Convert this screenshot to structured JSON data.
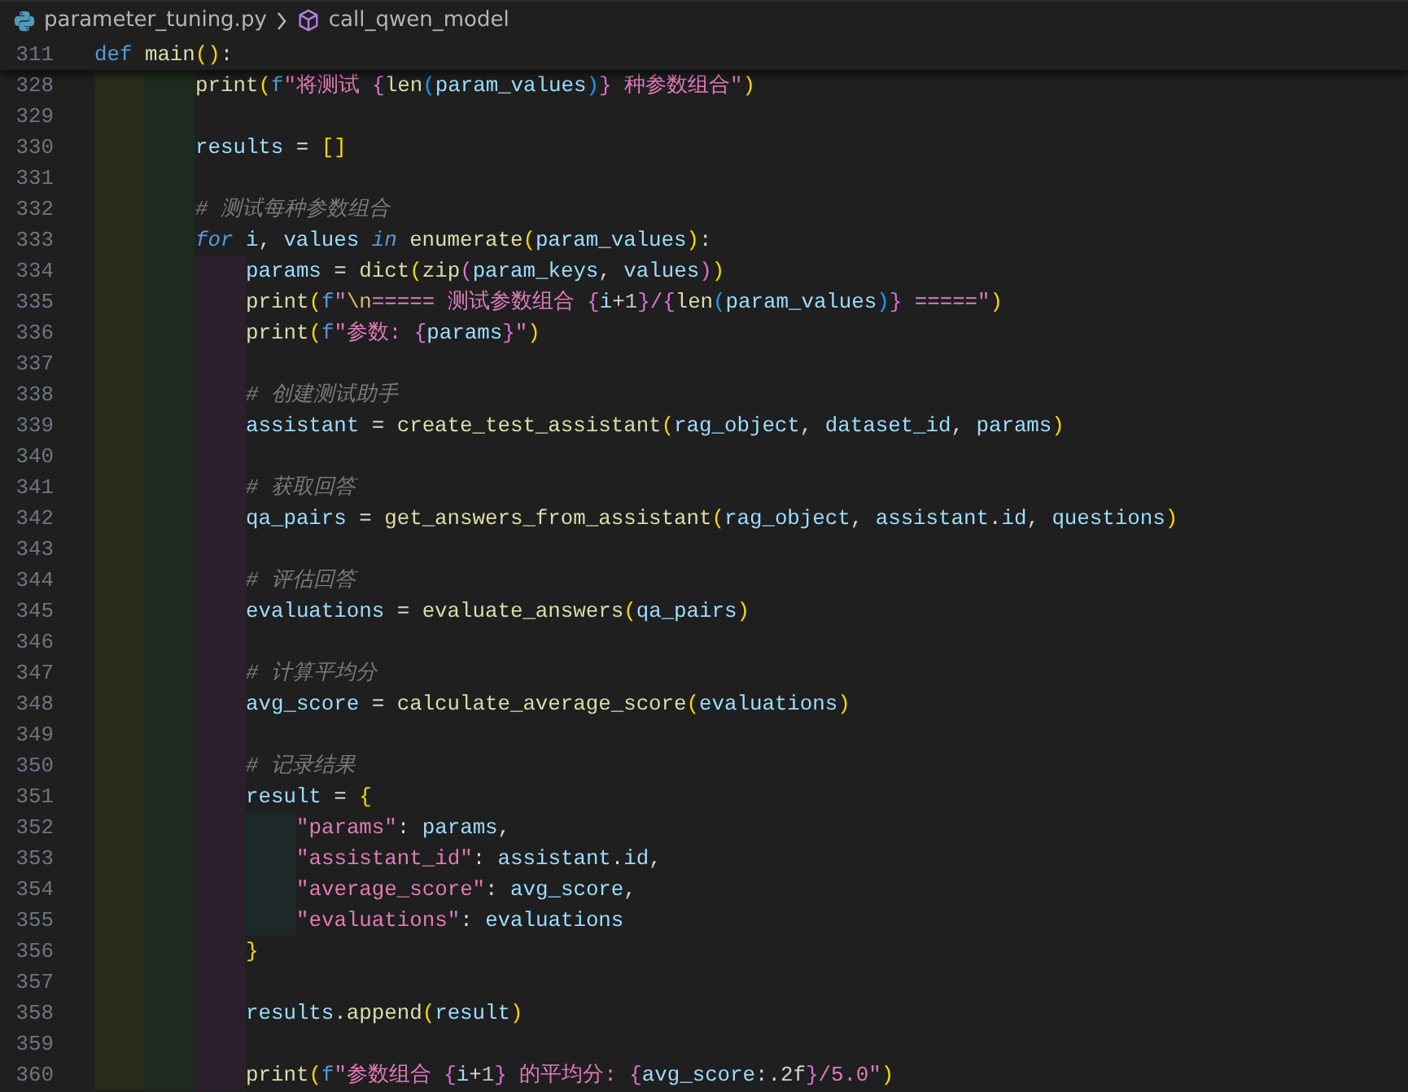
{
  "breadcrumb": {
    "file": "parameter_tuning.py",
    "symbol": "call_qwen_model"
  },
  "sticky_line": {
    "number": "311",
    "tokens": [
      {
        "kind": "keyword",
        "text": "def "
      },
      {
        "kind": "function",
        "text": "main"
      },
      {
        "kind": "bracket1",
        "text": "()"
      },
      {
        "kind": "plain",
        "text": ":"
      }
    ]
  },
  "lines": [
    {
      "children": [
        {
          "children": [
            {
              "number": "328",
              "tokens": [
                {
                  "kind": "function",
                  "text": "print"
                },
                {
                  "kind": "bracket1",
                  "text": "("
                },
                {
                  "kind": "keyword",
                  "text": "f"
                },
                {
                  "kind": "string",
                  "text": "\"将测试 "
                },
                {
                  "kind": "bracket2",
                  "text": "{"
                },
                {
                  "kind": "function",
                  "text": "len"
                },
                {
                  "kind": "bracket3",
                  "text": "("
                },
                {
                  "kind": "variable",
                  "text": "param_values"
                },
                {
                  "kind": "bracket3",
                  "text": ")"
                },
                {
                  "kind": "bracket2",
                  "text": "}"
                },
                {
                  "kind": "string",
                  "text": " 种参数组合\""
                },
                {
                  "kind": "bracket1",
                  "text": ")"
                }
              ]
            },
            {
              "number": "329"
            },
            {
              "number": "330",
              "tokens": [
                {
                  "kind": "variable",
                  "text": "results"
                },
                {
                  "kind": "plain",
                  "text": " = "
                },
                {
                  "kind": "bracket1",
                  "text": "[]"
                }
              ]
            },
            {
              "number": "331"
            },
            {
              "number": "332",
              "tokens": [
                {
                  "kind": "comment",
                  "text": "# 测试每种参数组合"
                }
              ]
            },
            {
              "number": "333",
              "tokens": [
                {
                  "kind": "control",
                  "text": "for "
                },
                {
                  "kind": "variable",
                  "text": "i"
                },
                {
                  "kind": "plain",
                  "text": ", "
                },
                {
                  "kind": "variable",
                  "text": "values "
                },
                {
                  "kind": "control",
                  "text": "in "
                },
                {
                  "kind": "function",
                  "text": "enumerate"
                },
                {
                  "kind": "bracket1",
                  "text": "("
                },
                {
                  "kind": "variable",
                  "text": "param_values"
                },
                {
                  "kind": "bracket1",
                  "text": ")"
                },
                {
                  "kind": "plain",
                  "text": ":"
                }
              ],
              "children": [
                {
                  "number": "334",
                  "tokens": [
                    {
                      "kind": "variable",
                      "text": "params"
                    },
                    {
                      "kind": "plain",
                      "text": " = "
                    },
                    {
                      "kind": "function",
                      "text": "dict"
                    },
                    {
                      "kind": "bracket1",
                      "text": "("
                    },
                    {
                      "kind": "function",
                      "text": "zip"
                    },
                    {
                      "kind": "bracket2",
                      "text": "("
                    },
                    {
                      "kind": "variable",
                      "text": "param_keys"
                    },
                    {
                      "kind": "plain",
                      "text": ", "
                    },
                    {
                      "kind": "variable",
                      "text": "values"
                    },
                    {
                      "kind": "bracket2",
                      "text": ")"
                    },
                    {
                      "kind": "bracket1",
                      "text": ")"
                    }
                  ]
                },
                {
                  "number": "335",
                  "tokens": [
                    {
                      "kind": "function",
                      "text": "print"
                    },
                    {
                      "kind": "bracket1",
                      "text": "("
                    },
                    {
                      "kind": "keyword",
                      "text": "f"
                    },
                    {
                      "kind": "string",
                      "text": "\""
                    },
                    {
                      "kind": "escape",
                      "text": "\\n"
                    },
                    {
                      "kind": "string",
                      "text": "===== 测试参数组合 "
                    },
                    {
                      "kind": "bracket2",
                      "text": "{"
                    },
                    {
                      "kind": "variable",
                      "text": "i"
                    },
                    {
                      "kind": "plain",
                      "text": "+"
                    },
                    {
                      "kind": "number",
                      "text": "1"
                    },
                    {
                      "kind": "bracket2",
                      "text": "}"
                    },
                    {
                      "kind": "string",
                      "text": "/"
                    },
                    {
                      "kind": "bracket2",
                      "text": "{"
                    },
                    {
                      "kind": "function",
                      "text": "len"
                    },
                    {
                      "kind": "bracket3",
                      "text": "("
                    },
                    {
                      "kind": "variable",
                      "text": "param_values"
                    },
                    {
                      "kind": "bracket3",
                      "text": ")"
                    },
                    {
                      "kind": "bracket2",
                      "text": "}"
                    },
                    {
                      "kind": "string",
                      "text": " =====\""
                    },
                    {
                      "kind": "bracket1",
                      "text": ")"
                    }
                  ]
                },
                {
                  "number": "336",
                  "tokens": [
                    {
                      "kind": "function",
                      "text": "print"
                    },
                    {
                      "kind": "bracket1",
                      "text": "("
                    },
                    {
                      "kind": "keyword",
                      "text": "f"
                    },
                    {
                      "kind": "string",
                      "text": "\"参数: "
                    },
                    {
                      "kind": "bracket2",
                      "text": "{"
                    },
                    {
                      "kind": "variable",
                      "text": "params"
                    },
                    {
                      "kind": "bracket2",
                      "text": "}"
                    },
                    {
                      "kind": "string",
                      "text": "\""
                    },
                    {
                      "kind": "bracket1",
                      "text": ")"
                    }
                  ]
                },
                {
                  "number": "337"
                },
                {
                  "number": "338",
                  "tokens": [
                    {
                      "kind": "comment",
                      "text": "# 创建测试助手"
                    }
                  ]
                },
                {
                  "number": "339",
                  "tokens": [
                    {
                      "kind": "variable",
                      "text": "assistant"
                    },
                    {
                      "kind": "plain",
                      "text": " = "
                    },
                    {
                      "kind": "function",
                      "text": "create_test_assistant"
                    },
                    {
                      "kind": "bracket1",
                      "text": "("
                    },
                    {
                      "kind": "variable",
                      "text": "rag_object"
                    },
                    {
                      "kind": "plain",
                      "text": ", "
                    },
                    {
                      "kind": "variable",
                      "text": "dataset_id"
                    },
                    {
                      "kind": "plain",
                      "text": ", "
                    },
                    {
                      "kind": "variable",
                      "text": "params"
                    },
                    {
                      "kind": "bracket1",
                      "text": ")"
                    }
                  ]
                },
                {
                  "number": "340"
                },
                {
                  "number": "341",
                  "tokens": [
                    {
                      "kind": "comment",
                      "text": "# 获取回答"
                    }
                  ]
                },
                {
                  "number": "342",
                  "tokens": [
                    {
                      "kind": "variable",
                      "text": "qa_pairs"
                    },
                    {
                      "kind": "plain",
                      "text": " = "
                    },
                    {
                      "kind": "function",
                      "text": "get_answers_from_assistant"
                    },
                    {
                      "kind": "bracket1",
                      "text": "("
                    },
                    {
                      "kind": "variable",
                      "text": "rag_object"
                    },
                    {
                      "kind": "plain",
                      "text": ", "
                    },
                    {
                      "kind": "variable",
                      "text": "assistant"
                    },
                    {
                      "kind": "plain",
                      "text": "."
                    },
                    {
                      "kind": "variable",
                      "text": "id"
                    },
                    {
                      "kind": "plain",
                      "text": ", "
                    },
                    {
                      "kind": "variable",
                      "text": "questions"
                    },
                    {
                      "kind": "bracket1",
                      "text": ")"
                    }
                  ]
                },
                {
                  "number": "343"
                },
                {
                  "number": "344",
                  "tokens": [
                    {
                      "kind": "comment",
                      "text": "# 评估回答"
                    }
                  ]
                },
                {
                  "number": "345",
                  "tokens": [
                    {
                      "kind": "variable",
                      "text": "evaluations"
                    },
                    {
                      "kind": "plain",
                      "text": " = "
                    },
                    {
                      "kind": "function",
                      "text": "evaluate_answers"
                    },
                    {
                      "kind": "bracket1",
                      "text": "("
                    },
                    {
                      "kind": "variable",
                      "text": "qa_pairs"
                    },
                    {
                      "kind": "bracket1",
                      "text": ")"
                    }
                  ]
                },
                {
                  "number": "346"
                },
                {
                  "number": "347",
                  "tokens": [
                    {
                      "kind": "comment",
                      "text": "# 计算平均分"
                    }
                  ]
                },
                {
                  "number": "348",
                  "tokens": [
                    {
                      "kind": "variable",
                      "text": "avg_score"
                    },
                    {
                      "kind": "plain",
                      "text": " = "
                    },
                    {
                      "kind": "function",
                      "text": "calculate_average_score"
                    },
                    {
                      "kind": "bracket1",
                      "text": "("
                    },
                    {
                      "kind": "variable",
                      "text": "evaluations"
                    },
                    {
                      "kind": "bracket1",
                      "text": ")"
                    }
                  ]
                },
                {
                  "number": "349"
                },
                {
                  "number": "350",
                  "tokens": [
                    {
                      "kind": "comment",
                      "text": "# 记录结果"
                    }
                  ]
                },
                {
                  "number": "351",
                  "tokens": [
                    {
                      "kind": "variable",
                      "text": "result"
                    },
                    {
                      "kind": "plain",
                      "text": " = "
                    },
                    {
                      "kind": "bracket1",
                      "text": "{"
                    }
                  ],
                  "children": [
                    {
                      "number": "352",
                      "tokens": [
                        {
                          "kind": "string",
                          "text": "\"params\""
                        },
                        {
                          "kind": "plain",
                          "text": ": "
                        },
                        {
                          "kind": "variable",
                          "text": "params"
                        },
                        {
                          "kind": "plain",
                          "text": ","
                        }
                      ]
                    },
                    {
                      "number": "353",
                      "tokens": [
                        {
                          "kind": "string",
                          "text": "\"assistant_id\""
                        },
                        {
                          "kind": "plain",
                          "text": ": "
                        },
                        {
                          "kind": "variable",
                          "text": "assistant"
                        },
                        {
                          "kind": "plain",
                          "text": "."
                        },
                        {
                          "kind": "variable",
                          "text": "id"
                        },
                        {
                          "kind": "plain",
                          "text": ","
                        }
                      ]
                    },
                    {
                      "number": "354",
                      "tokens": [
                        {
                          "kind": "string",
                          "text": "\"average_score\""
                        },
                        {
                          "kind": "plain",
                          "text": ": "
                        },
                        {
                          "kind": "variable",
                          "text": "avg_score"
                        },
                        {
                          "kind": "plain",
                          "text": ","
                        }
                      ]
                    },
                    {
                      "number": "355",
                      "tokens": [
                        {
                          "kind": "string",
                          "text": "\"evaluations\""
                        },
                        {
                          "kind": "plain",
                          "text": ": "
                        },
                        {
                          "kind": "variable",
                          "text": "evaluations"
                        }
                      ]
                    }
                  ]
                },
                {
                  "number": "356",
                  "tokens": [
                    {
                      "kind": "bracket1",
                      "text": "}"
                    }
                  ]
                },
                {
                  "number": "357"
                },
                {
                  "number": "358",
                  "tokens": [
                    {
                      "kind": "variable",
                      "text": "results"
                    },
                    {
                      "kind": "plain",
                      "text": "."
                    },
                    {
                      "kind": "function",
                      "text": "append"
                    },
                    {
                      "kind": "bracket1",
                      "text": "("
                    },
                    {
                      "kind": "variable",
                      "text": "result"
                    },
                    {
                      "kind": "bracket1",
                      "text": ")"
                    }
                  ]
                },
                {
                  "number": "359"
                },
                {
                  "number": "360",
                  "tokens": [
                    {
                      "kind": "function",
                      "text": "print"
                    },
                    {
                      "kind": "bracket1",
                      "text": "("
                    },
                    {
                      "kind": "keyword",
                      "text": "f"
                    },
                    {
                      "kind": "string",
                      "text": "\"参数组合 "
                    },
                    {
                      "kind": "bracket2",
                      "text": "{"
                    },
                    {
                      "kind": "variable",
                      "text": "i"
                    },
                    {
                      "kind": "plain",
                      "text": "+"
                    },
                    {
                      "kind": "number",
                      "text": "1"
                    },
                    {
                      "kind": "bracket2",
                      "text": "}"
                    },
                    {
                      "kind": "string",
                      "text": " 的平均分: "
                    },
                    {
                      "kind": "bracket2",
                      "text": "{"
                    },
                    {
                      "kind": "variable",
                      "text": "avg_score"
                    },
                    {
                      "kind": "plain",
                      "text": ":.2f"
                    },
                    {
                      "kind": "bracket2",
                      "text": "}"
                    },
                    {
                      "kind": "string",
                      "text": "/5.0\""
                    },
                    {
                      "kind": "bracket1",
                      "text": ")"
                    }
                  ]
                }
              ]
            }
          ]
        }
      ]
    }
  ]
}
